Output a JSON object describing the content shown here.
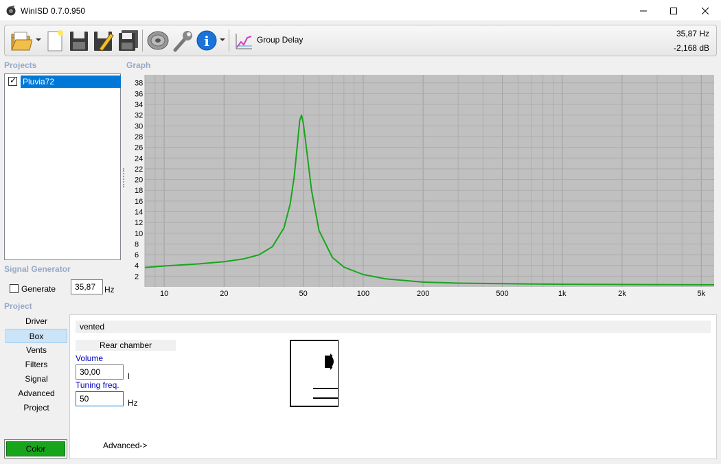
{
  "window": {
    "title": "WinISD 0.7.0.950"
  },
  "window_controls": {
    "minimize": "—",
    "maximize": "☐",
    "close": "✕"
  },
  "toolbar": {
    "icons": [
      "open-folder-icon",
      "new-document-icon",
      "save-icon",
      "save-as-icon",
      "save-all-icon",
      "speaker-icon",
      "wrench-icon",
      "info-icon",
      "group-delay-icon"
    ],
    "group_delay_label": "Group Delay",
    "readout_freq": "35,87 Hz",
    "readout_db": "-2,168 dB"
  },
  "projects": {
    "header": "Projects",
    "items": [
      {
        "label": "Pluvia72",
        "checked": true,
        "selected": true
      }
    ]
  },
  "graph": {
    "header": "Graph"
  },
  "chart_data": {
    "type": "line",
    "title": "",
    "xlabel": "",
    "ylabel": "",
    "x_scale": "log",
    "xlim": [
      8,
      5800
    ],
    "ylim": [
      0,
      39.5
    ],
    "x_ticks": [
      10,
      20,
      50,
      100,
      200,
      500,
      1000,
      2000,
      5000
    ],
    "x_tick_labels": [
      "10",
      "20",
      "50",
      "100",
      "200",
      "500",
      "1k",
      "2k",
      "5k"
    ],
    "y_ticks": [
      2,
      4,
      6,
      8,
      10,
      12,
      14,
      16,
      18,
      20,
      22,
      24,
      26,
      28,
      30,
      32,
      34,
      36,
      38
    ],
    "grid": true,
    "background": "#c0c0c0",
    "series": [
      {
        "name": "",
        "color": "#18a51c",
        "x": [
          8,
          10,
          15,
          20,
          25,
          30,
          35,
          40,
          43,
          45,
          47,
          48,
          49,
          50,
          52,
          55,
          60,
          70,
          80,
          100,
          130,
          200,
          300,
          500,
          1000,
          2000,
          5800
        ],
        "y": [
          3.6,
          3.9,
          4.3,
          4.7,
          5.2,
          6.0,
          7.5,
          11.0,
          15.5,
          20.5,
          27.5,
          31.0,
          32.0,
          30.5,
          25.5,
          18.0,
          10.5,
          5.5,
          3.7,
          2.3,
          1.5,
          0.9,
          0.7,
          0.6,
          0.5,
          0.45,
          0.4
        ]
      }
    ]
  },
  "signal_generator": {
    "header": "Signal Generator",
    "generate_label": "Generate",
    "generate_checked": false,
    "freq_value": "35,87",
    "unit": "Hz"
  },
  "project": {
    "header": "Project",
    "nav": [
      "Driver",
      "Box",
      "Vents",
      "Filters",
      "Signal",
      "Advanced",
      "Project"
    ],
    "active_nav": "Box",
    "color_button": "Color",
    "color": "#18a51c"
  },
  "box": {
    "type": "vented",
    "rear_chamber": "Rear chamber",
    "volume_label": "Volume",
    "volume_value": "30,00",
    "volume_unit": "l",
    "tuning_label": "Tuning freq.",
    "tuning_value": "50",
    "tuning_unit": "Hz",
    "advanced_link": "Advanced->"
  }
}
